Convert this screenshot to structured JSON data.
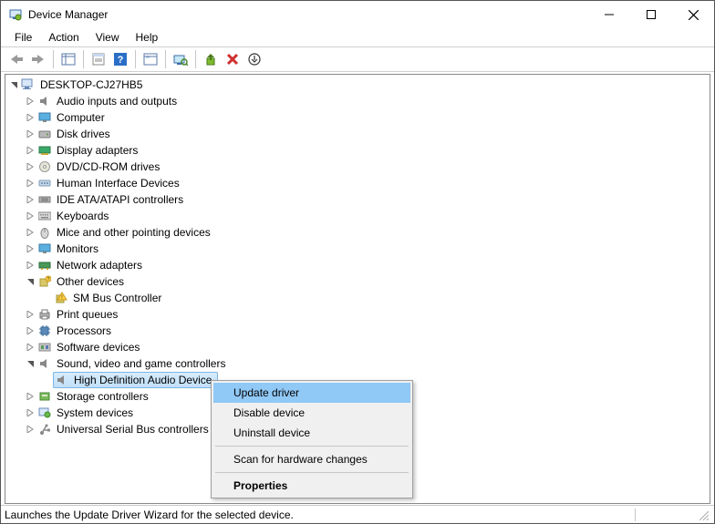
{
  "window": {
    "title": "Device Manager"
  },
  "menubar": {
    "file": "File",
    "action": "Action",
    "view": "View",
    "help": "Help"
  },
  "tree": {
    "root": "DESKTOP-CJ27HB5",
    "nodes": {
      "audio": "Audio inputs and outputs",
      "computer": "Computer",
      "disk": "Disk drives",
      "display": "Display adapters",
      "dvd": "DVD/CD-ROM drives",
      "hid": "Human Interface Devices",
      "ide": "IDE ATA/ATAPI controllers",
      "keyboards": "Keyboards",
      "mice": "Mice and other pointing devices",
      "monitors": "Monitors",
      "network": "Network adapters",
      "other": "Other devices",
      "other_child": "SM Bus Controller",
      "print": "Print queues",
      "processors": "Processors",
      "software": "Software devices",
      "sound": "Sound, video and game controllers",
      "sound_child": "High Definition Audio Device",
      "storage": "Storage controllers",
      "system": "System devices",
      "usb": "Universal Serial Bus controllers"
    }
  },
  "context_menu": {
    "update": "Update driver",
    "disable": "Disable device",
    "uninstall": "Uninstall device",
    "scan": "Scan for hardware changes",
    "properties": "Properties"
  },
  "statusbar": {
    "text": "Launches the Update Driver Wizard for the selected device."
  }
}
